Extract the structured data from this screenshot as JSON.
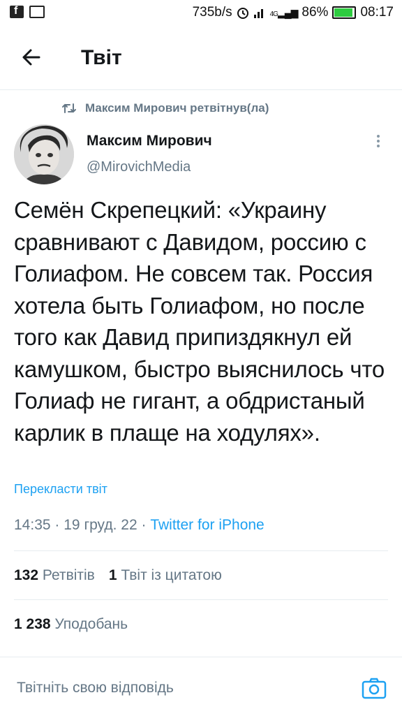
{
  "status_bar": {
    "speed": "735b/s",
    "network": "4G",
    "battery_percent": "86%",
    "battery_level": 0.86,
    "time": "08:17",
    "left_icons": [
      "facebook-icon",
      "image-icon"
    ],
    "right_icons": [
      "alarm-icon",
      "signal-icon",
      "signal-4g-icon",
      "battery-icon"
    ]
  },
  "header": {
    "title": "Твіт",
    "back_icon": "arrow-left-icon"
  },
  "retweet": {
    "text": "Максим Мирович ретвітнув(ла)",
    "icon": "retweet-icon"
  },
  "author": {
    "name": "Максим Мирович",
    "handle": "@MirovichMedia",
    "avatar": "avatar"
  },
  "tweet": {
    "text": "Семён Скрепецкий: «Украину сравнивают с Давидом, россию с Голиафом. Не совсем так. Россия хотела быть Голиафом, но после того как Давид припиздякнул ей камушком, быстро выяснилось что Голиаф не гигант, а обдристаный карлик в плаще на ходулях».",
    "translate_label": "Перекласти твіт",
    "time": "14:35",
    "date": "19 груд. 22",
    "separator": "·",
    "source": "Twitter for iPhone"
  },
  "stats": {
    "retweets_count": "132",
    "retweets_label": "Ретвітів",
    "quotes_count": "1",
    "quotes_label": "Твіт із цитатою",
    "likes_count": "1 238",
    "likes_label": "Уподобань"
  },
  "reply": {
    "placeholder": "Твітніть свою відповідь",
    "camera_icon": "camera-icon"
  },
  "colors": {
    "accent": "#1da1f2",
    "secondary_text": "#657786",
    "primary_text": "#14171a",
    "divider": "#e6ecf0"
  }
}
